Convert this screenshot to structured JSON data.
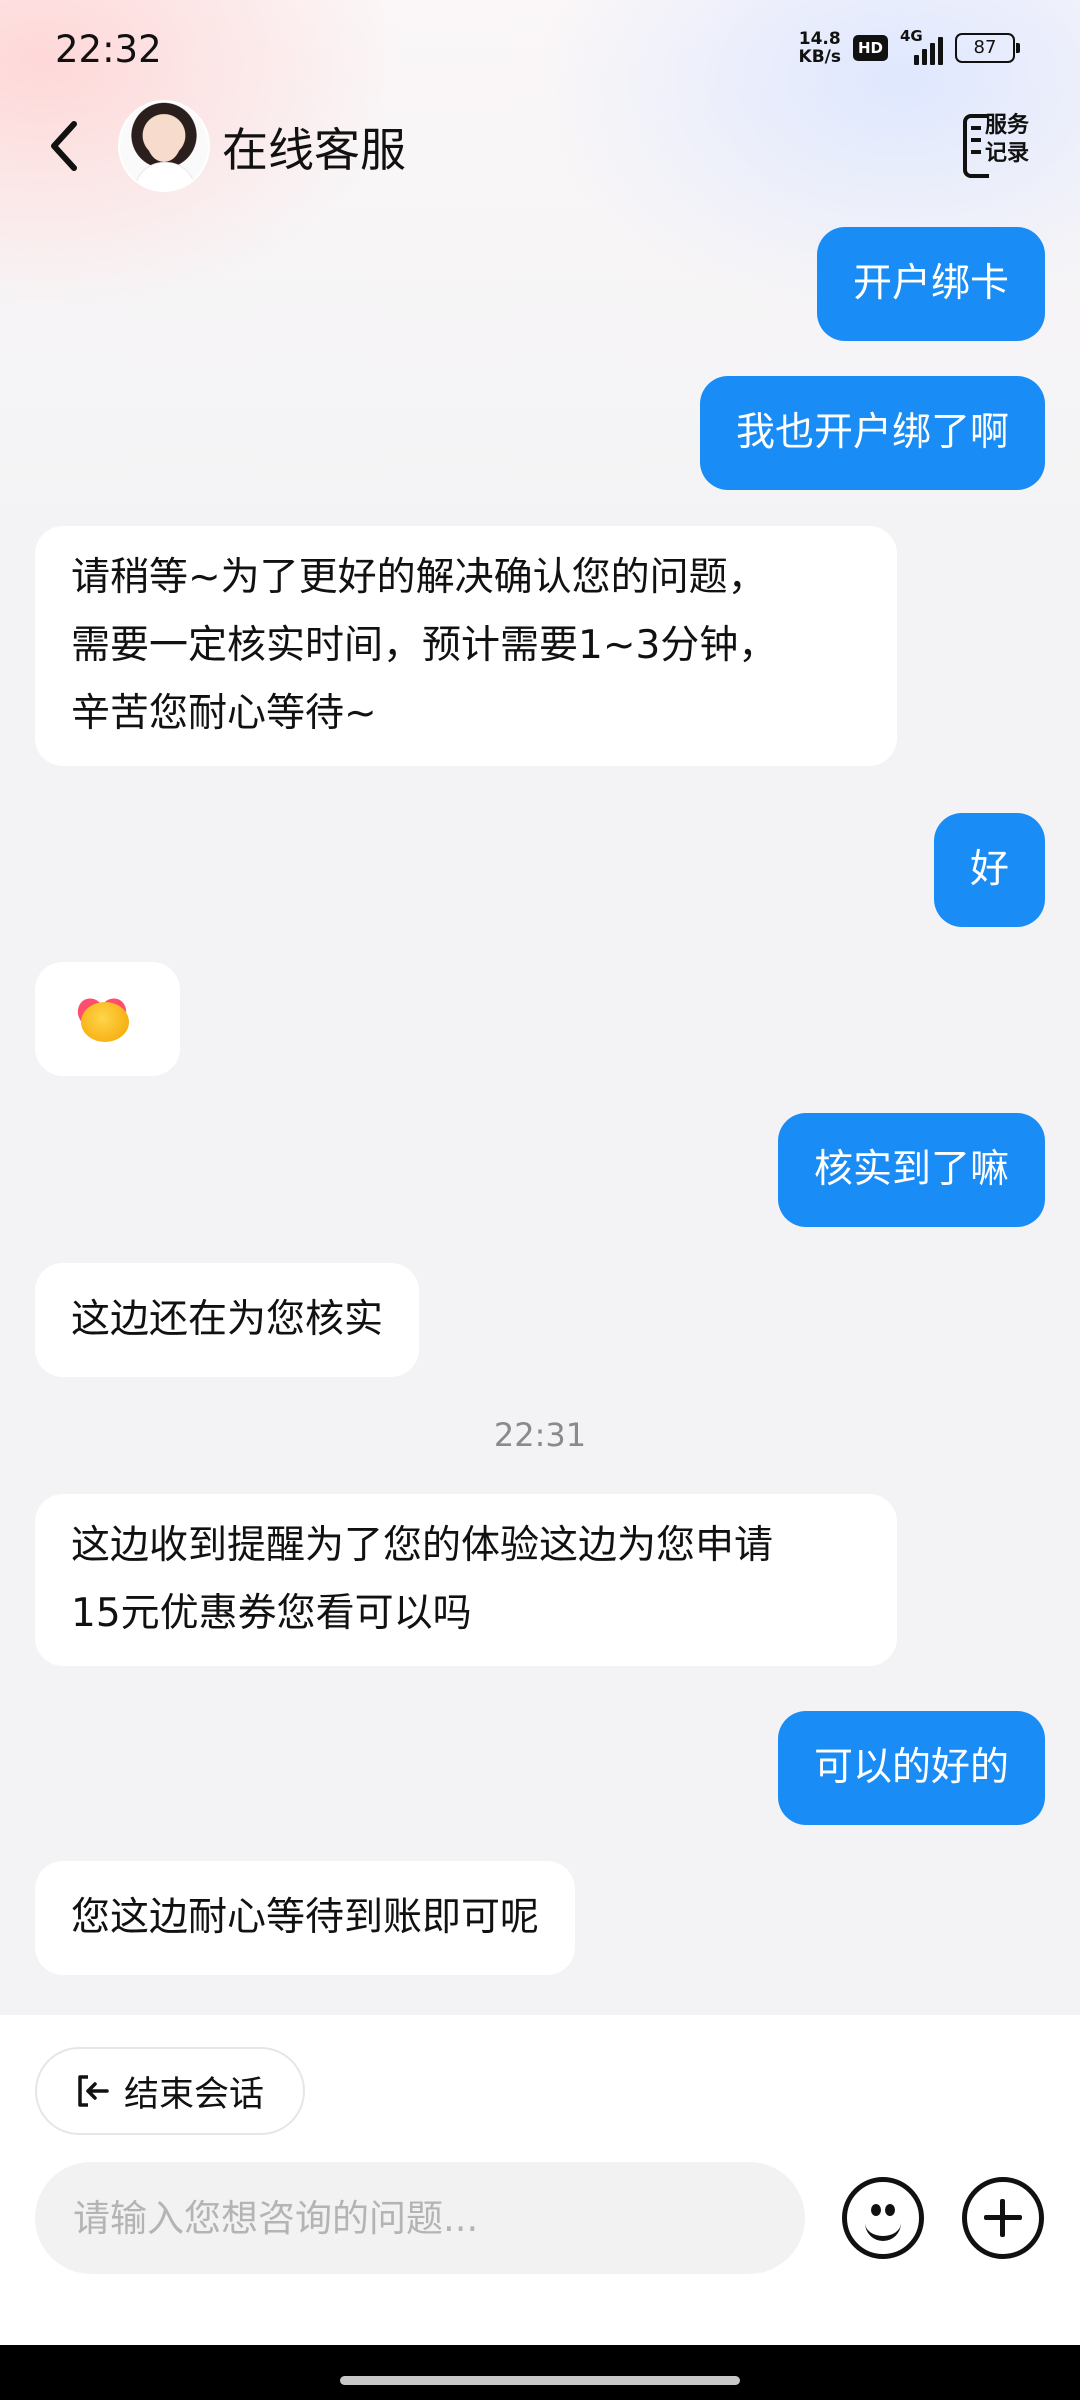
{
  "status_bar": {
    "time": "22:32",
    "net_speed_value": "14.8",
    "net_speed_unit": "KB/s",
    "hd_label": "HD",
    "network_type": "4G",
    "battery_level": "87"
  },
  "header": {
    "title": "在线客服",
    "service_record_label_line1": "服务",
    "service_record_label_line2": "记录",
    "back_icon": "chevron-left-icon"
  },
  "messages": [
    {
      "sender": "user",
      "text": "开户绑卡"
    },
    {
      "sender": "user",
      "text": "我也开户绑了啊"
    },
    {
      "sender": "agent",
      "lines": [
        "请稍等~为了更好的解决确认您的问题，",
        "需要一定核实时间，预计需要1~3分钟，",
        "辛苦您耐心等待~"
      ]
    },
    {
      "sender": "user",
      "text": "好"
    },
    {
      "sender": "agent",
      "sticker": "heart-hug-emoji"
    },
    {
      "sender": "user",
      "text": "核实到了嘛"
    },
    {
      "sender": "agent",
      "text": "这边还在为您核实"
    },
    {
      "sender": "agent",
      "lines": [
        "这边收到提醒为了您的体验这边为您申请",
        "15元优惠券您看可以吗"
      ]
    },
    {
      "sender": "user",
      "text": "可以的好的"
    },
    {
      "sender": "agent",
      "text": "您这边耐心等待到账即可呢"
    }
  ],
  "timestamp": "22:31",
  "bottom": {
    "end_session_label": "结束会话",
    "input_placeholder": "请输入您想咨询的问题...",
    "emoji_button_icon": "smiley-icon",
    "plus_button_icon": "plus-icon"
  },
  "colors": {
    "user_bubble": "#1a8cf5",
    "agent_bubble": "#ffffff",
    "background": "#f3f3f5"
  }
}
